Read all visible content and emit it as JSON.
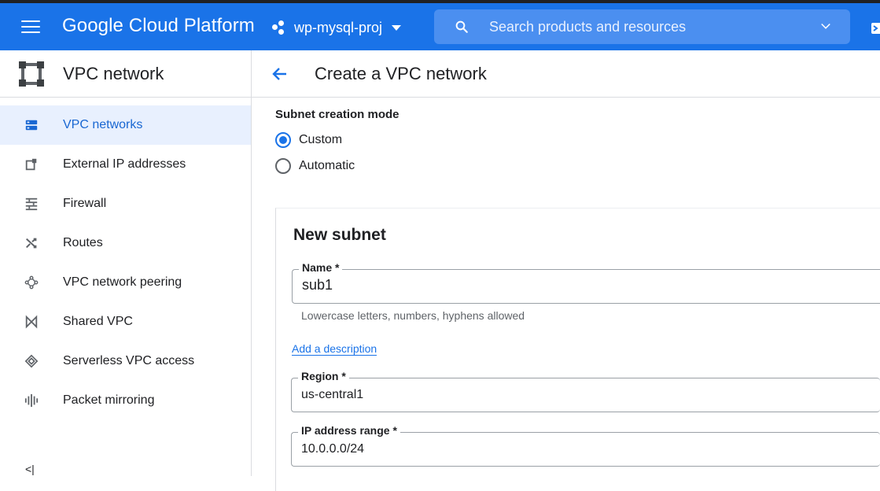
{
  "topbar": {
    "brand": "Google Cloud Platform",
    "project": "wp-mysql-proj",
    "search_placeholder": "Search products and resources"
  },
  "sidebar": {
    "title": "VPC network",
    "items": [
      {
        "label": "VPC networks",
        "icon": "vpc-networks-icon",
        "active": true
      },
      {
        "label": "External IP addresses",
        "icon": "external-ip-icon"
      },
      {
        "label": "Firewall",
        "icon": "firewall-icon"
      },
      {
        "label": "Routes",
        "icon": "routes-icon"
      },
      {
        "label": "VPC network peering",
        "icon": "peering-icon"
      },
      {
        "label": "Shared VPC",
        "icon": "shared-vpc-icon"
      },
      {
        "label": "Serverless VPC access",
        "icon": "serverless-icon"
      },
      {
        "label": "Packet mirroring",
        "icon": "packet-mirroring-icon"
      }
    ],
    "collapse_label": "<|"
  },
  "main": {
    "page_title": "Create a VPC network",
    "subnet_mode": {
      "label": "Subnet creation mode",
      "options": [
        "Custom",
        "Automatic"
      ],
      "selected": "Custom"
    },
    "new_subnet": {
      "title": "New subnet",
      "name_label": "Name *",
      "name_value": "sub1",
      "name_hint": "Lowercase letters, numbers, hyphens allowed",
      "add_description": "Add a description",
      "region_label": "Region *",
      "region_value": "us-central1",
      "ip_label": "IP address range *",
      "ip_value": "10.0.0.0/24"
    }
  },
  "colors": {
    "brand_blue": "#1a73e8",
    "active_bg": "#e8f0fe"
  }
}
